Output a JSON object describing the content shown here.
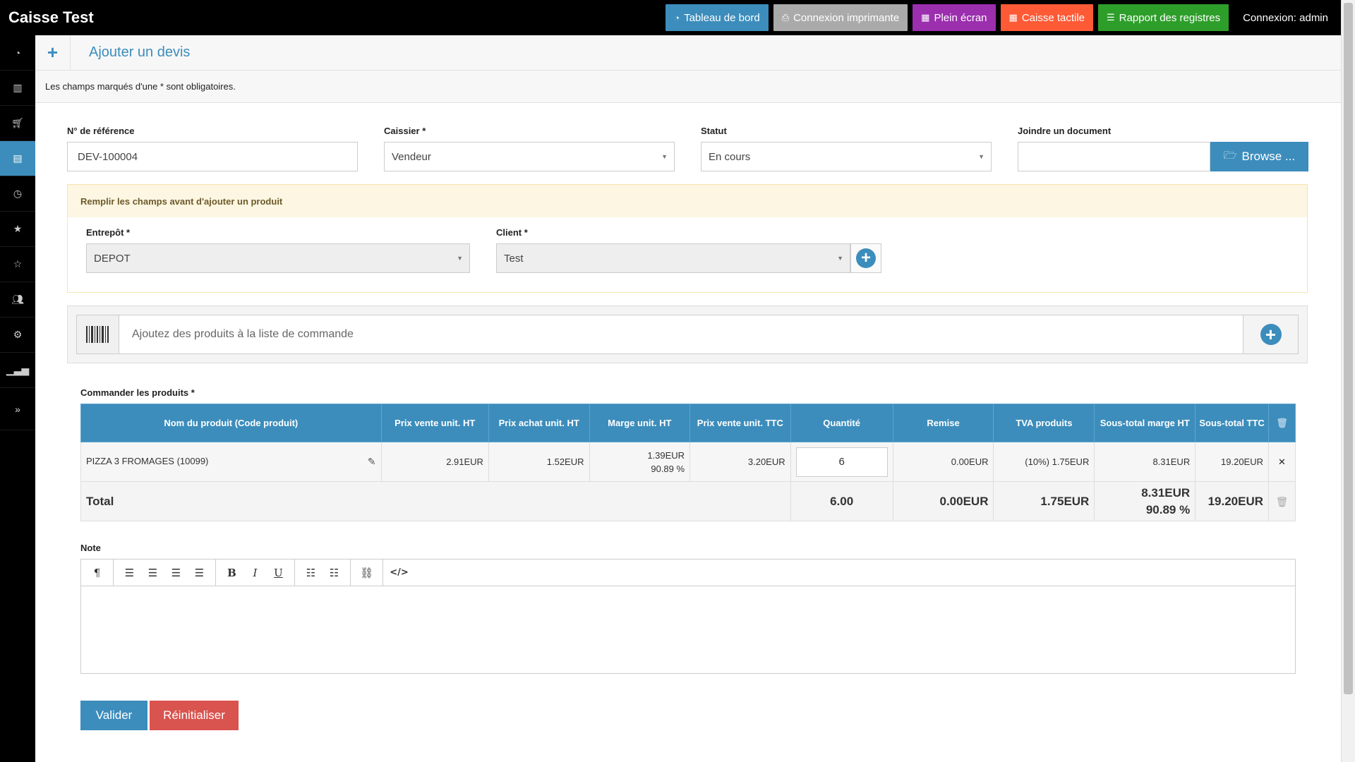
{
  "app": {
    "title": "Caisse Test"
  },
  "topnav": {
    "dashboard": "Tableau de bord",
    "printer": "Connexion imprimante",
    "fullscreen": "Plein écran",
    "touch": "Caisse tactile",
    "registers": "Rapport des registres",
    "login": "Connexion: admin"
  },
  "sidebar": {
    "items": [
      "dashboard-icon",
      "barcode-icon",
      "cart-icon",
      "document-icon",
      "clock-icon",
      "star-icon",
      "star-outline-icon",
      "users-icon",
      "gear-icon",
      "bar-chart-icon"
    ],
    "active_index": 3,
    "expand": "»"
  },
  "page": {
    "plus": "+",
    "title": "Ajouter un devis",
    "intro": "Les champs marqués d'une * sont obligatoires."
  },
  "form": {
    "reference": {
      "label": "N° de référence",
      "value": "DEV-100004"
    },
    "cashier": {
      "label": "Caissier *",
      "value": "Vendeur"
    },
    "status": {
      "label": "Statut",
      "value": "En cours"
    },
    "document": {
      "label": "Joindre un document",
      "value": "",
      "browse": "Browse ..."
    }
  },
  "warning": {
    "text": "Remplir les champs avant d'ajouter un produit",
    "warehouse": {
      "label": "Entrepôt *",
      "value": "DEPOT"
    },
    "client": {
      "label": "Client *",
      "value": "Test"
    }
  },
  "scanner": {
    "placeholder": "Ajoutez des produits à la liste de commande"
  },
  "order": {
    "label": "Commander les produits *",
    "headers": [
      "Nom du produit (Code produit)",
      "Prix vente unit. HT",
      "Prix achat unit. HT",
      "Marge unit. HT",
      "Prix vente unit. TTC",
      "Quantité",
      "Remise",
      "TVA produits",
      "Sous-total marge HT",
      "Sous-total TTC"
    ],
    "rows": [
      {
        "name": "PIZZA 3 FROMAGES (10099)",
        "sell_ht": "2.91EUR",
        "buy_ht": "1.52EUR",
        "margin": "1.39EUR",
        "margin_pct": "90.89 %",
        "sell_ttc": "3.20EUR",
        "qty": "6",
        "discount": "0.00EUR",
        "tva": "(10%) 1.75EUR",
        "subtotal_margin": "8.31EUR",
        "subtotal_ttc": "19.20EUR"
      }
    ],
    "total": {
      "label": "Total",
      "qty": "6.00",
      "discount": "0.00EUR",
      "tva": "1.75EUR",
      "margin": "8.31EUR",
      "margin_pct": "90.89 %",
      "ttc": "19.20EUR"
    }
  },
  "note": {
    "label": "Note",
    "value": ""
  },
  "actions": {
    "submit": "Valider",
    "reset": "Réinitialiser"
  }
}
